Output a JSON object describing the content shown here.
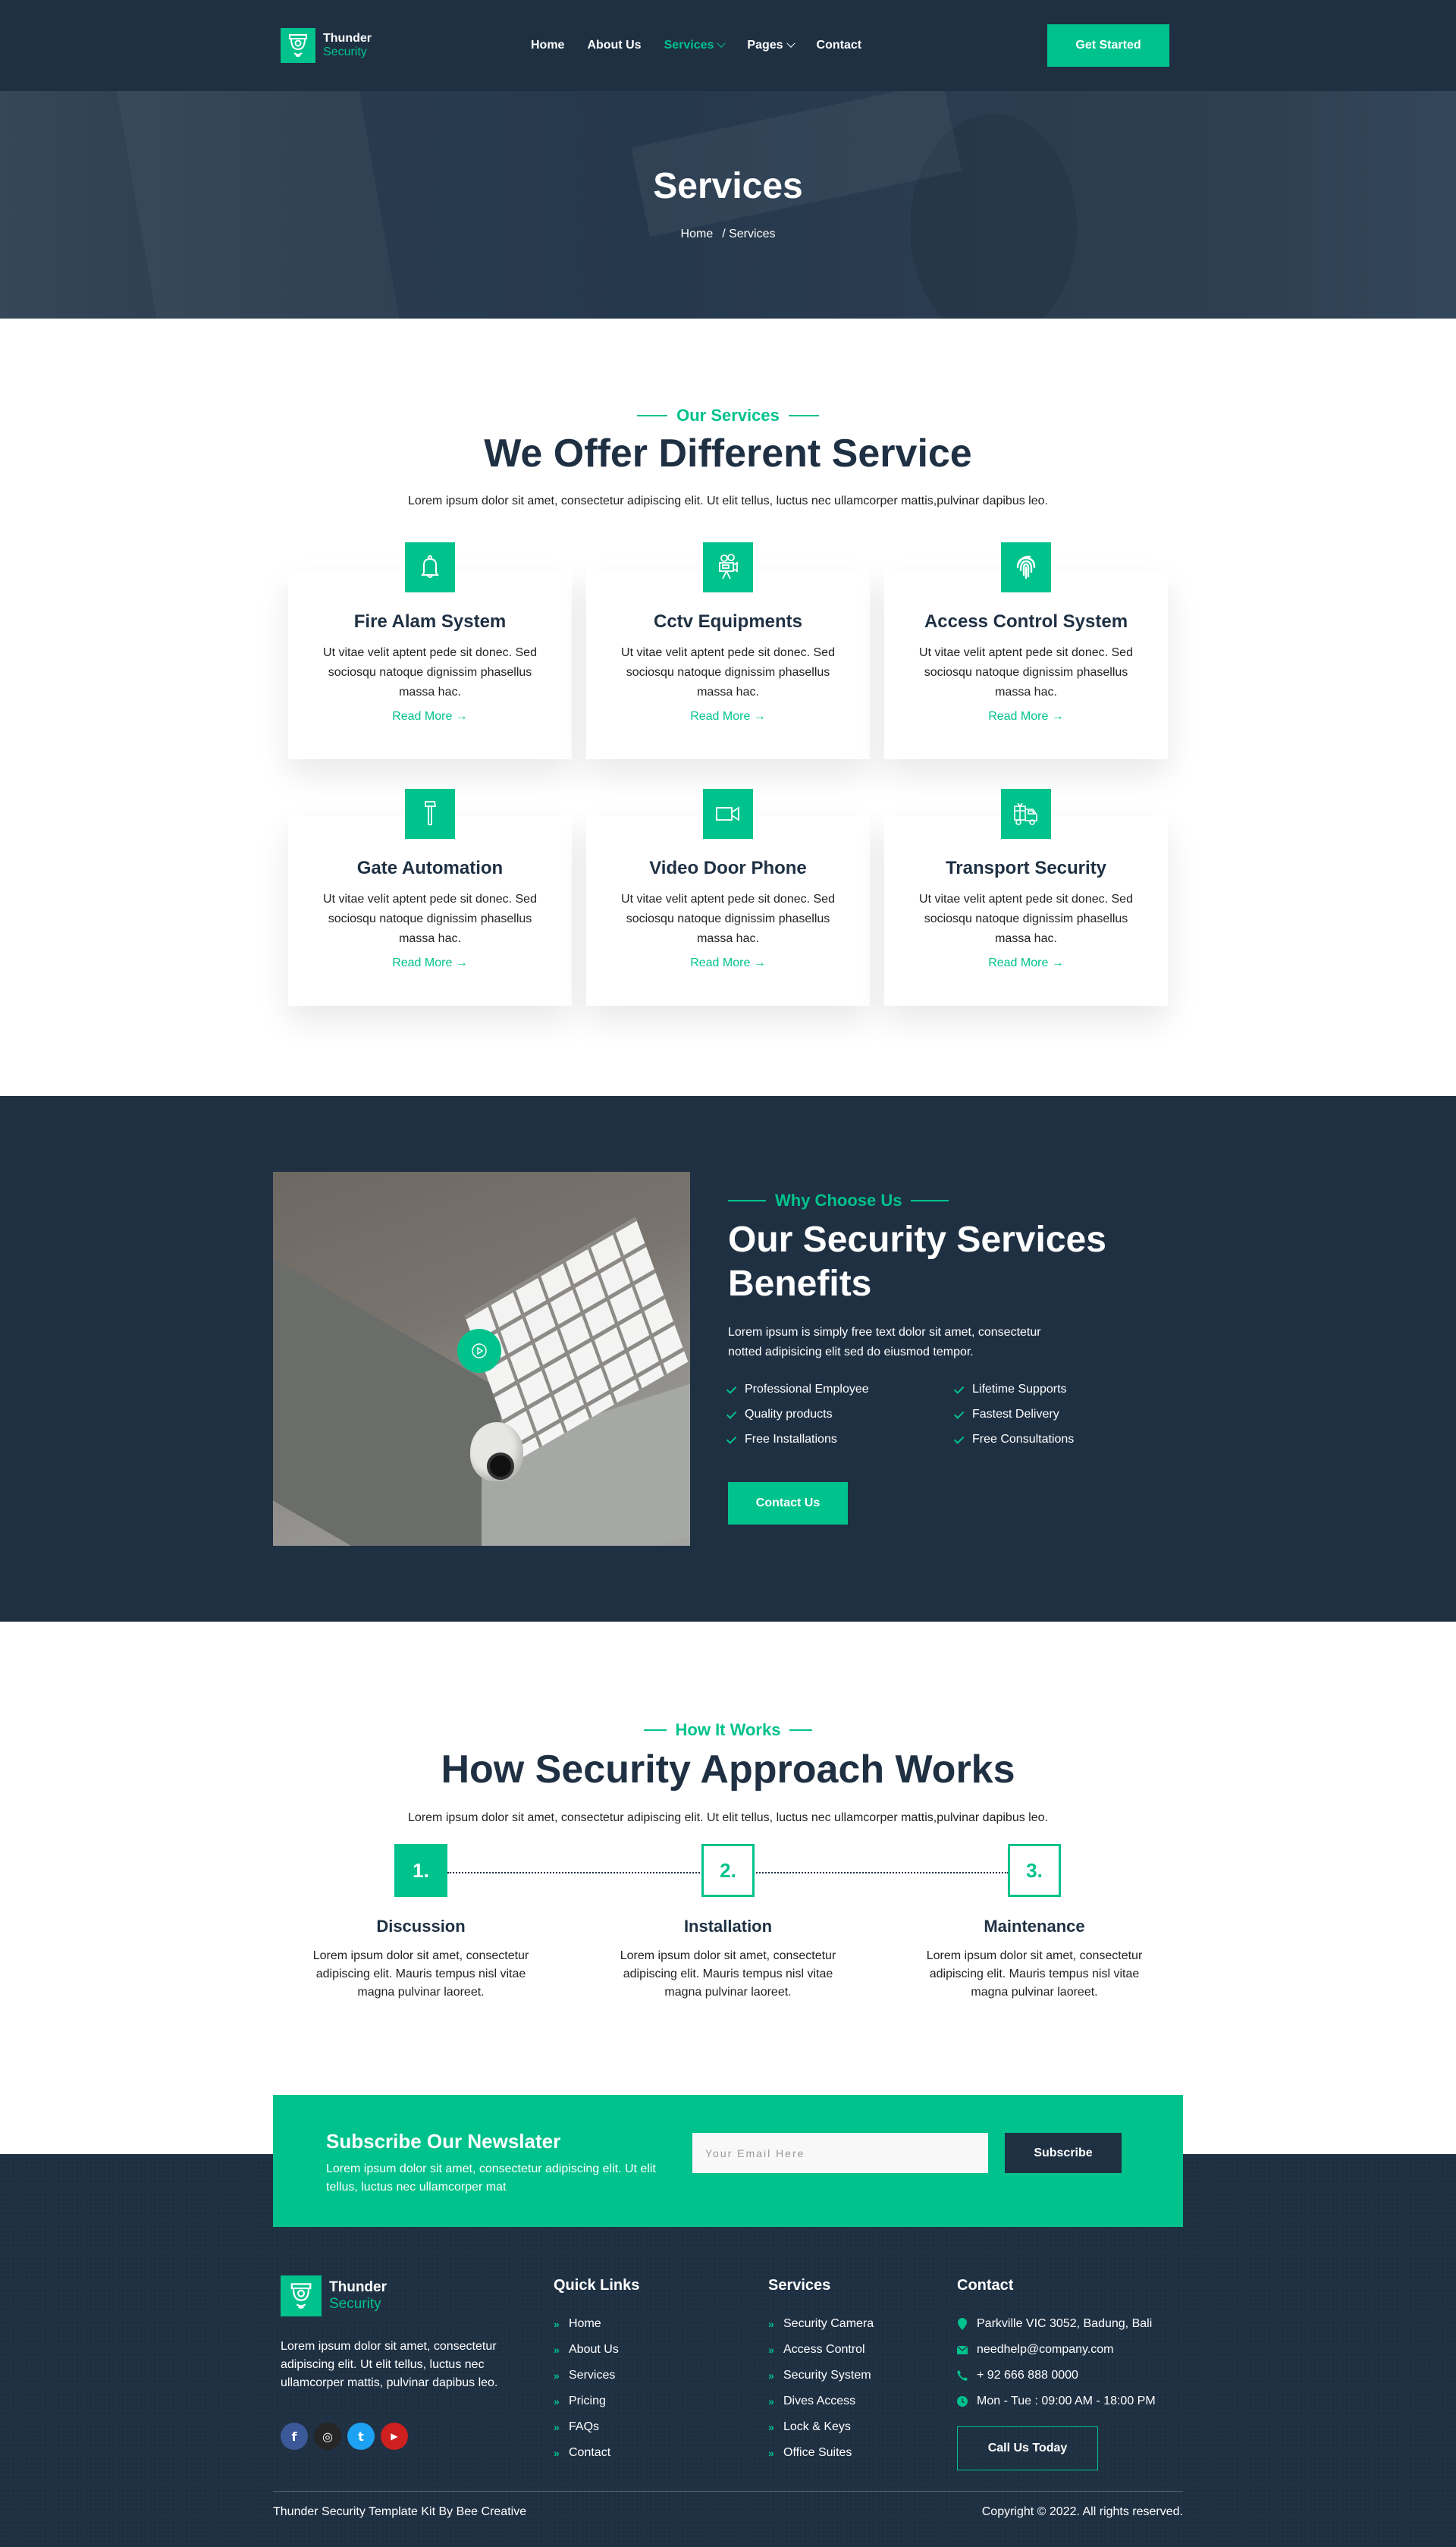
{
  "colors": {
    "brand_dark": "#1f3043",
    "accent": "#00c28c"
  },
  "header": {
    "logo": {
      "line1": "Thunder",
      "line2": "Security",
      "icon": "security-camera-icon"
    },
    "nav": [
      {
        "label": "Home",
        "active": false,
        "dropdown": false
      },
      {
        "label": "About Us",
        "active": false,
        "dropdown": false
      },
      {
        "label": "Services",
        "active": true,
        "dropdown": true
      },
      {
        "label": "Pages",
        "active": false,
        "dropdown": true
      },
      {
        "label": "Contact",
        "active": false,
        "dropdown": false
      }
    ],
    "cta_label": "Get Started"
  },
  "hero": {
    "title": "Services",
    "breadcrumb": {
      "home": "Home",
      "current": "/ Services"
    }
  },
  "services": {
    "tag": "Our Services",
    "title": "We Offer Different Service",
    "description": "Lorem ipsum dolor sit amet, consectetur adipiscing elit. Ut elit tellus, luctus nec ullamcorper mattis,pulvinar dapibus leo.",
    "cards": [
      {
        "title": "Fire Alam System",
        "icon": "bell-icon",
        "text": "Ut vitae velit aptent pede sit donec. Sed sociosqu natoque dignissim phasellus massa hac.",
        "link": "Read More →"
      },
      {
        "title": "Cctv Equipments",
        "icon": "video-camera-tripod-icon",
        "text": "Ut vitae velit aptent pede sit donec. Sed sociosqu natoque dignissim phasellus massa hac.",
        "link": "Read More →"
      },
      {
        "title": "Access Control System",
        "icon": "fingerprint-icon",
        "text": "Ut vitae velit aptent pede sit donec. Sed sociosqu natoque dignissim phasellus massa hac.",
        "link": "Read More →"
      },
      {
        "title": "Gate Automation",
        "icon": "hammer-icon",
        "text": "Ut vitae velit aptent pede sit donec. Sed sociosqu natoque dignissim phasellus massa hac.",
        "link": "Read More →"
      },
      {
        "title": "Video Door Phone",
        "icon": "video-icon",
        "text": "Ut vitae velit aptent pede sit donec. Sed sociosqu natoque dignissim phasellus massa hac.",
        "link": "Read More →"
      },
      {
        "title": "Transport Security",
        "icon": "delivery-truck-icon",
        "text": "Ut vitae velit aptent pede sit donec. Sed sociosqu natoque dignissim phasellus massa hac.",
        "link": "Read More →"
      }
    ]
  },
  "why": {
    "tag": "Why Choose Us",
    "title": "Our Security Services Benefits",
    "description": "Lorem ipsum is simply free text dolor sit amet, consectetur notted adipisicing elit sed do eiusmod tempor.",
    "benefits": [
      "Professional Employee",
      "Lifetime Supports",
      "Quality products",
      "Fastest Delivery",
      "Free Installations",
      "Free Consultations"
    ],
    "cta_label": "Contact Us"
  },
  "how": {
    "tag": "How It Works",
    "title": "How Security Approach Works",
    "description": "Lorem ipsum dolor sit amet, consectetur adipiscing elit. Ut elit tellus, luctus nec ullamcorper mattis,pulvinar dapibus leo.",
    "steps": [
      {
        "number": "1.",
        "title": "Discussion",
        "text": "Lorem ipsum dolor sit amet, consectetur adipiscing elit. Mauris tempus nisl vitae magna pulvinar laoreet."
      },
      {
        "number": "2.",
        "title": "Installation",
        "text": "Lorem ipsum dolor sit amet, consectetur adipiscing elit. Mauris tempus nisl vitae magna pulvinar laoreet."
      },
      {
        "number": "3.",
        "title": "Maintenance",
        "text": "Lorem ipsum dolor sit amet, consectetur adipiscing elit. Mauris tempus nisl vitae magna pulvinar laoreet."
      }
    ]
  },
  "subscribe": {
    "title": "Subscribe Our Newslater",
    "text": "Lorem ipsum dolor sit amet, consectetur adipiscing elit. Ut elit tellus, luctus nec ullamcorper mat",
    "email_placeholder": "Your Email Here",
    "email_value": "",
    "button_label": "Subscribe"
  },
  "footer": {
    "logo": {
      "line1": "Thunder",
      "line2": "Security"
    },
    "about": "Lorem ipsum dolor sit amet, consectetur adipiscing elit. Ut elit tellus, luctus nec ullamcorper mattis, pulvinar dapibus leo.",
    "socials": [
      {
        "name": "facebook",
        "glyph": "f",
        "color": "#3b5998"
      },
      {
        "name": "instagram",
        "glyph": "◎",
        "color": "#262626"
      },
      {
        "name": "twitter",
        "glyph": "t",
        "color": "#1da1f2"
      },
      {
        "name": "youtube",
        "glyph": "▶",
        "color": "#cd201f"
      }
    ],
    "quick_links": {
      "title": "Quick Links",
      "items": [
        "Home",
        "About Us",
        "Services",
        "Pricing",
        "FAQs",
        "Contact"
      ]
    },
    "services": {
      "title": "Services",
      "items": [
        "Security Camera",
        "Access Control",
        "Security System",
        "Dives Access",
        "Lock & Keys",
        "Office Suites"
      ]
    },
    "contact": {
      "title": "Contact",
      "items": [
        {
          "icon": "map-pin-icon",
          "text": "Parkville VIC 3052, Badung, Bali"
        },
        {
          "icon": "envelope-icon",
          "text": "needhelp@company.com"
        },
        {
          "icon": "phone-icon",
          "text": "+ 92 666 888 0000"
        },
        {
          "icon": "clock-icon",
          "text": "Mon - Tue : 09:00 AM - 18:00 PM"
        }
      ],
      "button_label": "Call Us Today"
    },
    "credit": "Thunder Security Template Kit By Bee Creative",
    "copyright": "Copyright © 2022. All rights reserved."
  }
}
